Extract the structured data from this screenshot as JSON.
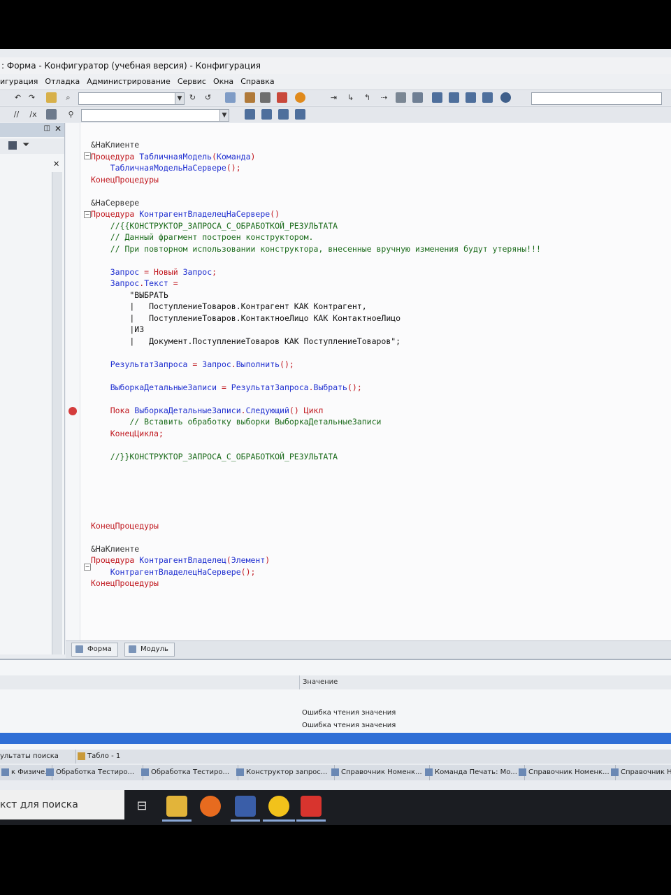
{
  "window": {
    "title": ": Форма - Конфигуратор (учебная версия) - Конфигурация"
  },
  "menu": [
    "игурация",
    "Отладка",
    "Администрирование",
    "Сервис",
    "Окна",
    "Справка"
  ],
  "code_lines": [
    {
      "parts": [
        {
          "t": "&НаКлиенте",
          "c": "pr"
        }
      ]
    },
    {
      "parts": [
        {
          "t": "Процедура ",
          "c": "kw"
        },
        {
          "t": "ТабличнаяМодель",
          "c": "id"
        },
        {
          "t": "(",
          "c": "kw"
        },
        {
          "t": "Команда",
          "c": "id"
        },
        {
          "t": ")",
          "c": "kw"
        }
      ]
    },
    {
      "parts": [
        {
          "t": "    ТабличнаяМодельНаСервере",
          "c": "id"
        },
        {
          "t": "();",
          "c": "kw"
        }
      ]
    },
    {
      "parts": [
        {
          "t": "КонецПроцедуры",
          "c": "kw"
        }
      ]
    },
    {
      "parts": []
    },
    {
      "parts": [
        {
          "t": "&НаСервере",
          "c": "pr"
        }
      ]
    },
    {
      "parts": [
        {
          "t": "Процедура ",
          "c": "kw"
        },
        {
          "t": "КонтрагентВладелецНаСервере",
          "c": "id"
        },
        {
          "t": "()",
          "c": "kw"
        }
      ]
    },
    {
      "parts": [
        {
          "t": "    //{{КОНСТРУКТОР_ЗАПРОСА_С_ОБРАБОТКОЙ_РЕЗУЛЬТАТА",
          "c": "cm"
        }
      ]
    },
    {
      "parts": [
        {
          "t": "    // Данный фрагмент построен конструктором.",
          "c": "cm"
        }
      ]
    },
    {
      "parts": [
        {
          "t": "    // При повторном использовании конструктора, внесенные вручную изменения будут утеряны!!!",
          "c": "cm"
        }
      ]
    },
    {
      "parts": []
    },
    {
      "parts": [
        {
          "t": "    Запрос",
          "c": "id"
        },
        {
          "t": " = ",
          "c": "kw"
        },
        {
          "t": "Новый ",
          "c": "kw"
        },
        {
          "t": "Запрос",
          "c": "id"
        },
        {
          "t": ";",
          "c": "kw"
        }
      ]
    },
    {
      "parts": [
        {
          "t": "    Запрос",
          "c": "id"
        },
        {
          "t": ".",
          "c": "kw"
        },
        {
          "t": "Текст",
          "c": "id"
        },
        {
          "t": " =",
          "c": "kw"
        }
      ]
    },
    {
      "parts": [
        {
          "t": "        \"ВЫБРАТЬ",
          "c": "str"
        }
      ]
    },
    {
      "parts": [
        {
          "t": "        |   ПоступлениеТоваров.Контрагент КАК Контрагент,",
          "c": "str"
        }
      ]
    },
    {
      "parts": [
        {
          "t": "        |   ПоступлениеТоваров.КонтактноеЛицо КАК КонтактноеЛицо",
          "c": "str"
        }
      ]
    },
    {
      "parts": [
        {
          "t": "        |ИЗ",
          "c": "str"
        }
      ]
    },
    {
      "parts": [
        {
          "t": "        |   Документ.ПоступлениеТоваров КАК ПоступлениеТоваров\";",
          "c": "str"
        }
      ]
    },
    {
      "parts": []
    },
    {
      "parts": [
        {
          "t": "    РезультатЗапроса",
          "c": "id"
        },
        {
          "t": " = ",
          "c": "kw"
        },
        {
          "t": "Запрос",
          "c": "id"
        },
        {
          "t": ".",
          "c": "kw"
        },
        {
          "t": "Выполнить",
          "c": "id"
        },
        {
          "t": "();",
          "c": "kw"
        }
      ]
    },
    {
      "parts": []
    },
    {
      "parts": [
        {
          "t": "    ВыборкаДетальныеЗаписи",
          "c": "id"
        },
        {
          "t": " = ",
          "c": "kw"
        },
        {
          "t": "РезультатЗапроса",
          "c": "id"
        },
        {
          "t": ".",
          "c": "kw"
        },
        {
          "t": "Выбрать",
          "c": "id"
        },
        {
          "t": "();",
          "c": "kw"
        }
      ]
    },
    {
      "parts": []
    },
    {
      "parts": [
        {
          "t": "    Пока ",
          "c": "kw"
        },
        {
          "t": "ВыборкаДетальныеЗаписи",
          "c": "id"
        },
        {
          "t": ".",
          "c": "kw"
        },
        {
          "t": "Следующий",
          "c": "id"
        },
        {
          "t": "() ",
          "c": "kw"
        },
        {
          "t": "Цикл",
          "c": "kw"
        }
      ]
    },
    {
      "parts": [
        {
          "t": "        // Вставить обработку выборки ВыборкаДетальныеЗаписи",
          "c": "cm"
        }
      ]
    },
    {
      "parts": [
        {
          "t": "    КонецЦикла",
          "c": "kw"
        },
        {
          "t": ";",
          "c": "kw"
        }
      ]
    },
    {
      "parts": []
    },
    {
      "parts": [
        {
          "t": "    //}}КОНСТРУКТОР_ЗАПРОСА_С_ОБРАБОТКОЙ_РЕЗУЛЬТАТА",
          "c": "cm"
        }
      ]
    },
    {
      "parts": []
    },
    {
      "parts": []
    },
    {
      "parts": []
    },
    {
      "parts": []
    },
    {
      "parts": []
    },
    {
      "parts": [
        {
          "t": "КонецПроцедуры",
          "c": "kw"
        }
      ]
    },
    {
      "parts": []
    },
    {
      "parts": [
        {
          "t": "&НаКлиенте",
          "c": "pr"
        }
      ]
    },
    {
      "parts": [
        {
          "t": "Процедура ",
          "c": "kw"
        },
        {
          "t": "КонтрагентВладелец",
          "c": "id"
        },
        {
          "t": "(",
          "c": "kw"
        },
        {
          "t": "Элемент",
          "c": "id"
        },
        {
          "t": ")",
          "c": "kw"
        }
      ]
    },
    {
      "parts": [
        {
          "t": "    КонтрагентВладелецНаСервере",
          "c": "id"
        },
        {
          "t": "();",
          "c": "kw"
        }
      ]
    },
    {
      "parts": [
        {
          "t": "КонецПроцедуры",
          "c": "kw"
        }
      ]
    }
  ],
  "editor_tabs": {
    "form": "Форма",
    "module": "Модуль"
  },
  "bottom_panel": {
    "column_header": "Значение",
    "rows": [
      "Ошибка чтения значения",
      "Ошибка чтения значения"
    ]
  },
  "bottom_tabs": {
    "search_results": "ультаты поиска",
    "table": "Табло - 1"
  },
  "taskbar_windows": [
    "к Физиче...",
    "Обработка Тестиро...",
    "Обработка Тестиро...",
    "Конструктор запрос...",
    "Справочник Номенк...",
    "Команда Печать: Мо...",
    "Справочник Номенк...",
    "Справочник Но"
  ],
  "search_box": {
    "placeholder": "кст для поиска"
  },
  "colors": {
    "keyword": "#c0171e",
    "identifier": "#1f2fd0",
    "comment": "#1b6b1b",
    "selection": "#2f6fd6"
  }
}
